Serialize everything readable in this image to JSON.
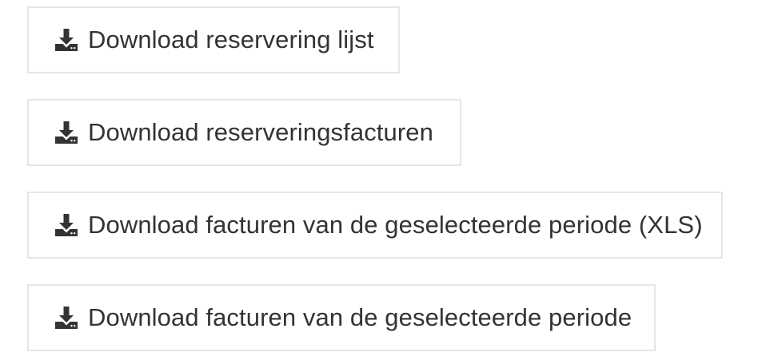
{
  "buttons": [
    {
      "label": "Download reservering lijst",
      "icon": "download-icon"
    },
    {
      "label": "Download reserveringsfacturen",
      "icon": "download-icon"
    },
    {
      "label": "Download facturen van de geselecteerde periode (XLS)",
      "icon": "download-icon"
    },
    {
      "label": "Download facturen van de geselecteerde periode",
      "icon": "download-icon"
    }
  ],
  "colors": {
    "text": "#333333",
    "icon": "#333333",
    "border": "#e6e6e6",
    "background": "#ffffff"
  }
}
